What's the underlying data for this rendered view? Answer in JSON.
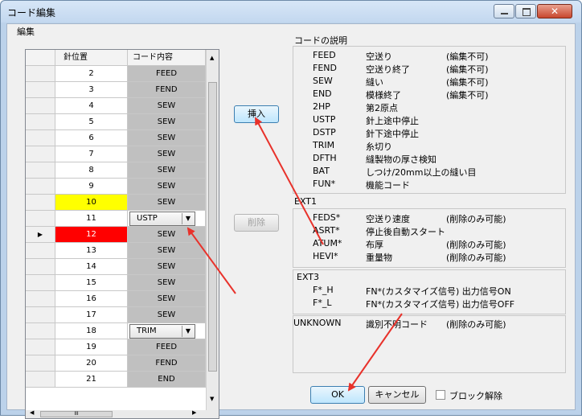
{
  "window": {
    "title": "コード編集"
  },
  "edit": {
    "group_label": "編集",
    "col_pos": "針位置",
    "col_code": "コード内容",
    "rows": [
      {
        "pos": "2",
        "code": "FEED",
        "mark": "",
        "highlight": "",
        "type": "text"
      },
      {
        "pos": "3",
        "code": "FEND",
        "mark": "",
        "highlight": "",
        "type": "text"
      },
      {
        "pos": "4",
        "code": "SEW",
        "mark": "",
        "highlight": "",
        "type": "text"
      },
      {
        "pos": "5",
        "code": "SEW",
        "mark": "",
        "highlight": "",
        "type": "text"
      },
      {
        "pos": "6",
        "code": "SEW",
        "mark": "",
        "highlight": "",
        "type": "text"
      },
      {
        "pos": "7",
        "code": "SEW",
        "mark": "",
        "highlight": "",
        "type": "text"
      },
      {
        "pos": "8",
        "code": "SEW",
        "mark": "",
        "highlight": "",
        "type": "text"
      },
      {
        "pos": "9",
        "code": "SEW",
        "mark": "",
        "highlight": "",
        "type": "text"
      },
      {
        "pos": "10",
        "code": "SEW",
        "mark": "",
        "highlight": "#ffff00",
        "type": "text"
      },
      {
        "pos": "11",
        "code": "USTP",
        "mark": "",
        "highlight": "",
        "type": "combo"
      },
      {
        "pos": "12",
        "code": "SEW",
        "mark": "▶",
        "highlight": "#ff0000",
        "type": "text"
      },
      {
        "pos": "13",
        "code": "SEW",
        "mark": "",
        "highlight": "",
        "type": "text"
      },
      {
        "pos": "14",
        "code": "SEW",
        "mark": "",
        "highlight": "",
        "type": "text"
      },
      {
        "pos": "15",
        "code": "SEW",
        "mark": "",
        "highlight": "",
        "type": "text"
      },
      {
        "pos": "16",
        "code": "SEW",
        "mark": "",
        "highlight": "",
        "type": "text"
      },
      {
        "pos": "17",
        "code": "SEW",
        "mark": "",
        "highlight": "",
        "type": "text"
      },
      {
        "pos": "18",
        "code": "TRIM",
        "mark": "",
        "highlight": "",
        "type": "combo"
      },
      {
        "pos": "19",
        "code": "FEED",
        "mark": "",
        "highlight": "",
        "type": "text"
      },
      {
        "pos": "20",
        "code": "FEND",
        "mark": "",
        "highlight": "",
        "type": "text"
      },
      {
        "pos": "21",
        "code": "END",
        "mark": "",
        "highlight": "",
        "type": "text"
      }
    ],
    "insert_label": "挿入",
    "delete_label": "削除",
    "hscroll_thumb": "III"
  },
  "desc": {
    "label": "コードの説明",
    "group1": [
      {
        "code": "FEED",
        "desc": "空送り",
        "note": "(編集不可)"
      },
      {
        "code": "FEND",
        "desc": "空送り終了",
        "note": "(編集不可)"
      },
      {
        "code": "SEW",
        "desc": "縫い",
        "note": "(編集不可)"
      },
      {
        "code": "END",
        "desc": "模様終了",
        "note": "(編集不可)"
      },
      {
        "code": "2HP",
        "desc": "第2原点",
        "note": ""
      },
      {
        "code": "USTP",
        "desc": "針上途中停止",
        "note": ""
      },
      {
        "code": "DSTP",
        "desc": "針下途中停止",
        "note": ""
      },
      {
        "code": "TRIM",
        "desc": "糸切り",
        "note": ""
      },
      {
        "code": "DFTH",
        "desc": "縫製物の厚さ検知",
        "note": ""
      },
      {
        "code": "BAT",
        "desc": "しつけ/20mm以上の縫い目",
        "note": ""
      },
      {
        "code": "FUN*",
        "desc": "機能コード",
        "note": ""
      }
    ],
    "ext1_label": "EXT1",
    "group2": [
      {
        "code": "FEDS*",
        "desc": "空送り速度",
        "note": "(削除のみ可能)"
      },
      {
        "code": "ASRT*",
        "desc": "停止後自動スタート",
        "note": ""
      },
      {
        "code": "ATUM*",
        "desc": "布厚",
        "note": "(削除のみ可能)"
      },
      {
        "code": "HEVI*",
        "desc": "重量物",
        "note": "(削除のみ可能)"
      }
    ],
    "ext3_label": "EXT3",
    "group3": [
      {
        "code": "F*_H",
        "desc": "FN*(カスタマイズ信号) 出力信号ON",
        "note": ""
      },
      {
        "code": "F*_L",
        "desc": "FN*(カスタマイズ信号) 出力信号OFF",
        "note": ""
      }
    ],
    "group4": [
      {
        "code": "UNKNOWN",
        "desc": "識別不明コード",
        "note": "(削除のみ可能)"
      }
    ]
  },
  "footer": {
    "ok_label": "OK",
    "cancel_label": "キャンセル",
    "unblock_label": "ブロック解除"
  },
  "colors": {
    "arrow": "#e8322b",
    "title_bg": "#c9dcf1"
  }
}
